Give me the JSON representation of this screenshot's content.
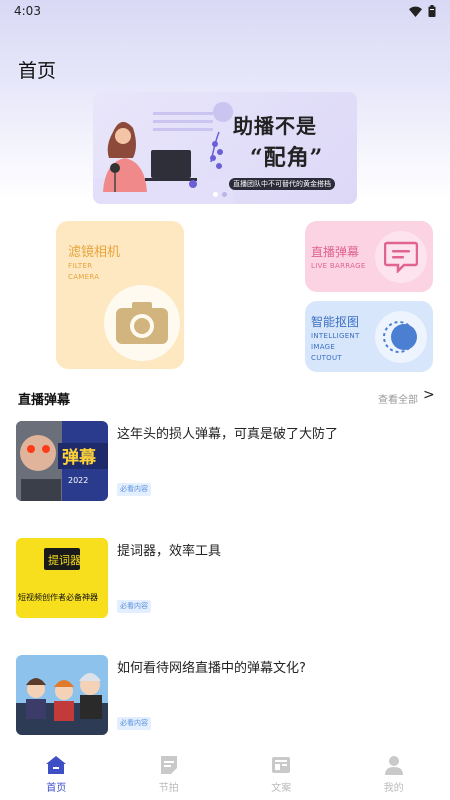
{
  "status_bar": {
    "time": "4:03"
  },
  "header": {
    "title": "首页"
  },
  "banner": {
    "headline_1": "助播不是",
    "headline_2": "“配角”",
    "subline": "直播团队中不可替代的黄金搭档"
  },
  "features": {
    "filter_camera": {
      "title": "滤镜相机",
      "sub_1": "FILTER",
      "sub_2": "CAMERA"
    },
    "live_barrage": {
      "title": "直播弹幕",
      "sub_1": "LIVE BARRAGE"
    },
    "smart_cutout": {
      "title": "智能抠图",
      "sub_1": "INTELLIGENT",
      "sub_2": "IMAGE",
      "sub_3": "CUTOUT"
    }
  },
  "section": {
    "title": "直播弹幕",
    "see_all": "查看全部",
    "arrow": ">"
  },
  "articles": [
    {
      "title": "这年头的损人弹幕，可真是破了大防了",
      "tag": "必看内容",
      "thumb_text": "弹幕",
      "thumb_sub": "2022"
    },
    {
      "title": "提词器，效率工具",
      "tag": "必看内容",
      "thumb_text": "提词器",
      "thumb_sub": "短视频创作者必备神器"
    },
    {
      "title": "如何看待网络直播中的弹幕文化?",
      "tag": "必看内容"
    }
  ],
  "bottom_nav": [
    {
      "label": "首页",
      "icon": "home-icon",
      "active": true
    },
    {
      "label": "节拍",
      "icon": "note-icon",
      "active": false
    },
    {
      "label": "文案",
      "icon": "document-icon",
      "active": false
    },
    {
      "label": "我的",
      "icon": "user-icon",
      "active": false
    }
  ],
  "colors": {
    "accent": "#3c4fc5",
    "filter_card": "#fde8c2",
    "barrage_card": "#fbd3e2",
    "cutout_card": "#d8e6fb",
    "tag_bg": "#e3efff"
  }
}
